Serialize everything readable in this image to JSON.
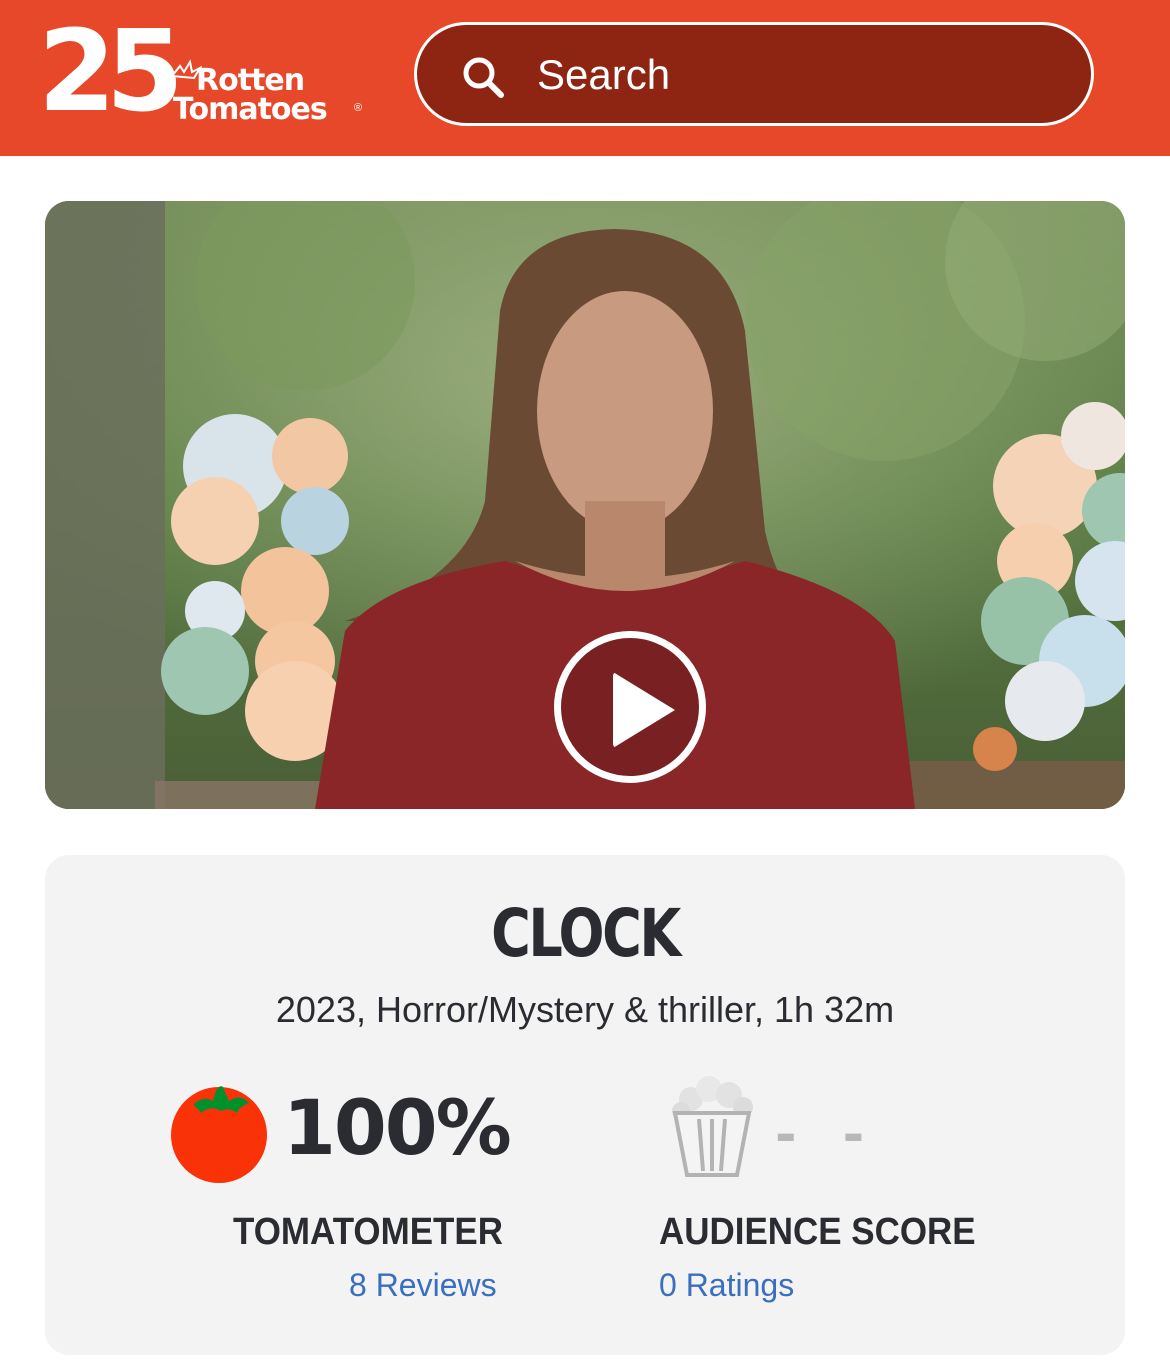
{
  "header": {
    "logo": {
      "number": "25",
      "word1": "Rotten",
      "word2": "Tomatoes",
      "registered": "®"
    },
    "search": {
      "placeholder": "Search",
      "icon": "search-icon"
    }
  },
  "video": {
    "play_icon": "play-icon"
  },
  "movie": {
    "title": "CLOCK",
    "meta": "2023, Horror/Mystery & thriller, 1h 32m"
  },
  "tomatometer": {
    "score": "100%",
    "label": "TOMATOMETER",
    "link": "8 Reviews",
    "icon": "tomato-icon"
  },
  "audience": {
    "score": "- -",
    "label": "AUDIENCE SCORE",
    "link": "0 Ratings",
    "icon": "popcorn-icon"
  },
  "colors": {
    "brand": "#e8482a",
    "search_bg": "#8e2412",
    "link": "#3a6fc0",
    "card_bg": "#f3f3f3",
    "text": "#2a2c32"
  }
}
